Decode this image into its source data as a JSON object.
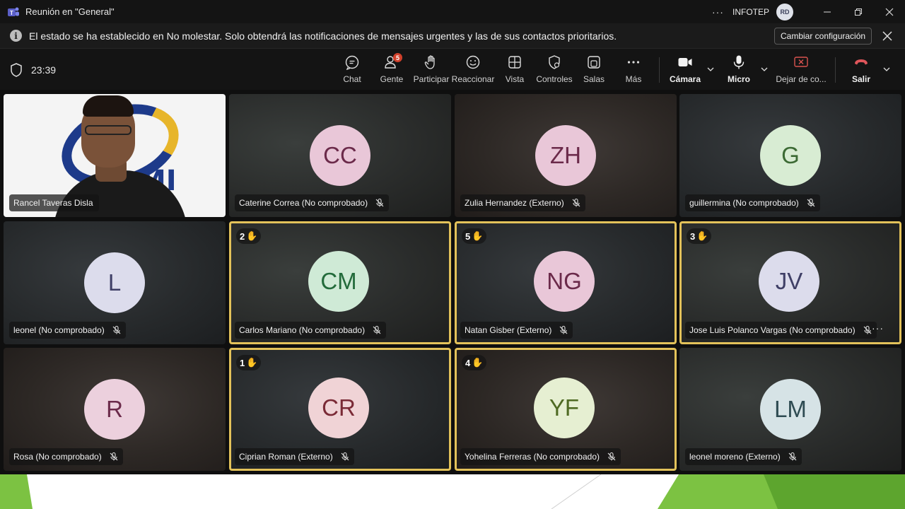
{
  "window": {
    "title": "Reunión en \"General\"",
    "org": "INFOTEP",
    "user_initials": "RD",
    "more_icon": "ellipsis-icon"
  },
  "banner": {
    "text": "El estado se ha establecido en No molestar. Solo obtendrá las notificaciones de mensajes urgentes y las de sus contactos prioritarios.",
    "button": "Cambiar configuración"
  },
  "toolbar": {
    "timer": "23:39",
    "people_badge": "5",
    "items": {
      "chat": "Chat",
      "people": "Gente",
      "raise": "Participar",
      "react": "Reaccionar",
      "view": "Vista",
      "controls": "Controles",
      "rooms": "Salas",
      "more": "Más",
      "camera": "Cámara",
      "mic": "Micro",
      "share": "Dejar de co...",
      "leave": "Salir"
    },
    "leave_color": "#e0565b"
  },
  "participants": [
    {
      "name": "Rancel Taveras Disla",
      "video": true
    },
    {
      "name": "Caterine Correa (No comprobado)",
      "initials": "CC",
      "avatar_bg": "#e9c7d8",
      "avatar_fg": "#6b2a4a"
    },
    {
      "name": "Zulia Hernandez (Externo)",
      "initials": "ZH",
      "avatar_bg": "#e9c7d8",
      "avatar_fg": "#6b2a4a"
    },
    {
      "name": "guillermina (No comprobado)",
      "initials": "G",
      "avatar_bg": "#d8ecd3",
      "avatar_fg": "#3c6a34"
    },
    {
      "name": "leonel (No comprobado)",
      "initials": "L",
      "avatar_bg": "#dcdcec",
      "avatar_fg": "#3f3f66"
    },
    {
      "name": "Carlos Mariano (No comprobado)",
      "initials": "CM",
      "avatar_bg": "#cfead6",
      "avatar_fg": "#236b3b",
      "hand": "2"
    },
    {
      "name": "Natan Gisber (Externo)",
      "initials": "NG",
      "avatar_bg": "#e9c7d8",
      "avatar_fg": "#6b2a4a",
      "hand": "5"
    },
    {
      "name": "Jose Luis Polanco Vargas (No comprobado)",
      "initials": "JV",
      "avatar_bg": "#dcdcec",
      "avatar_fg": "#3f3f66",
      "hand": "3"
    },
    {
      "name": "Rosa (No comprobado)",
      "initials": "R",
      "avatar_bg": "#ecd0dd",
      "avatar_fg": "#6b2a4a"
    },
    {
      "name": "Ciprian Roman (Externo)",
      "initials": "CR",
      "avatar_bg": "#f0d3d6",
      "avatar_fg": "#7a2a36",
      "hand": "1"
    },
    {
      "name": "Yohelina Ferreras (No comprobado)",
      "initials": "YF",
      "avatar_bg": "#e6efd2",
      "avatar_fg": "#4f6a23",
      "hand": "4"
    },
    {
      "name": "leonel moreno (Externo)",
      "initials": "LM",
      "avatar_bg": "#d6e3e6",
      "avatar_fg": "#2e4b52"
    }
  ],
  "colors": {
    "hand_border": "#e3c25a",
    "slide_green": "#7cc242"
  }
}
